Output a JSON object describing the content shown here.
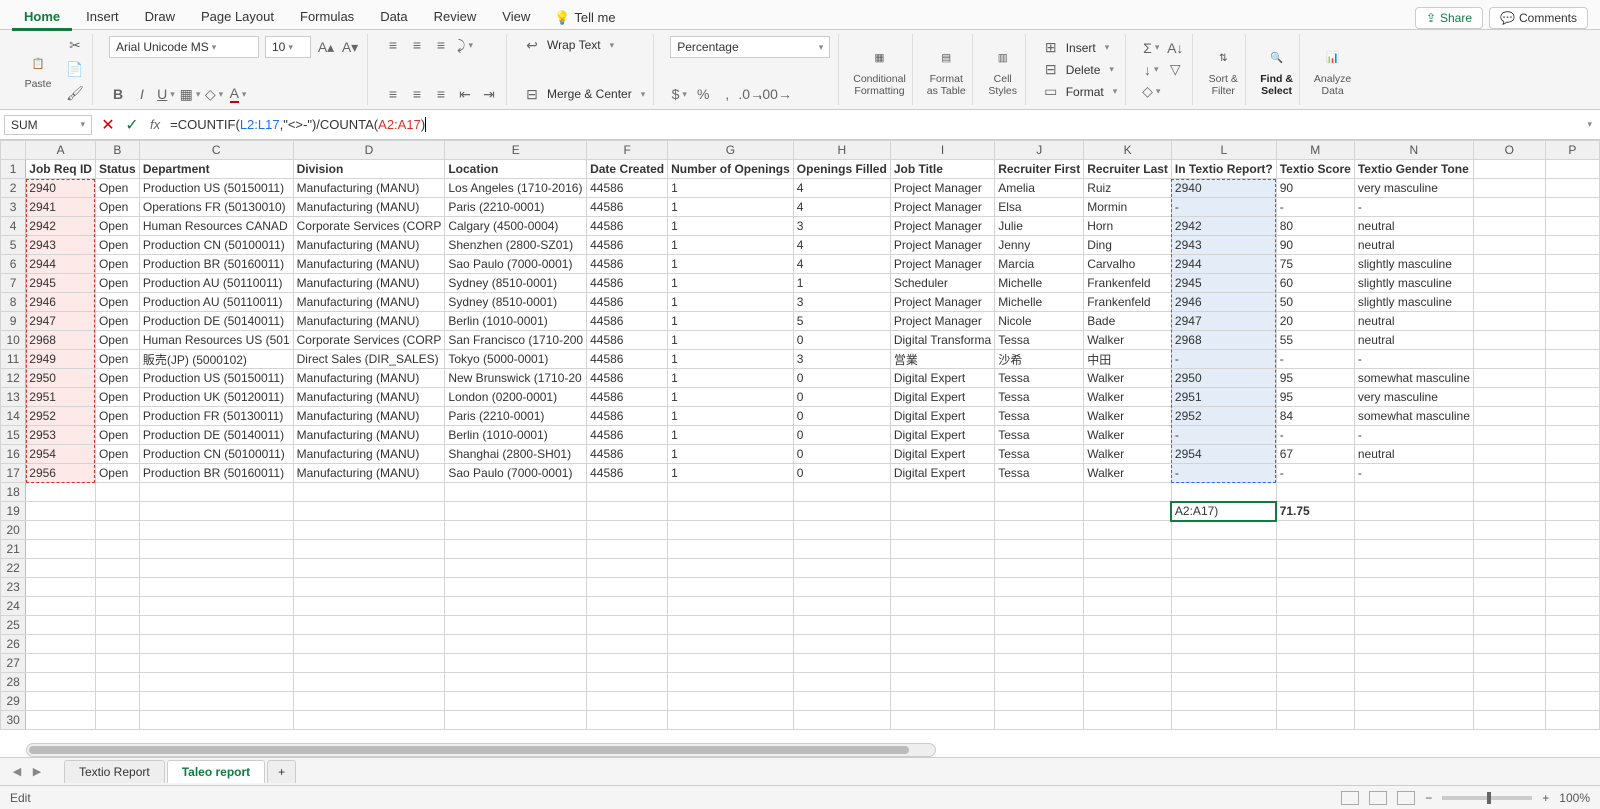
{
  "ribbonTabs": [
    "Home",
    "Insert",
    "Draw",
    "Page Layout",
    "Formulas",
    "Data",
    "Review",
    "View"
  ],
  "tellMe": "Tell me",
  "shareLabel": "Share",
  "commentsLabel": "Comments",
  "clipboard": {
    "paste": "Paste"
  },
  "font": {
    "name": "Arial Unicode MS",
    "size": "10"
  },
  "wrap": "Wrap Text",
  "merge": "Merge & Center",
  "numfmt": "Percentage",
  "cond": "Conditional\nFormatting",
  "fmtTable": "Format\nas Table",
  "cellStyles": "Cell\nStyles",
  "cells": {
    "insert": "Insert",
    "delete": "Delete",
    "format": "Format"
  },
  "sort": "Sort &\nFilter",
  "find": "Find &\nSelect",
  "analyze": "Analyze\nData",
  "nameBox": "SUM",
  "formula": {
    "pre": "=COUNTIF(",
    "ref1": "L2:L17",
    "mid": ",\"<>-\")/COUNTA(",
    "ref2": "A2:A17",
    "post": ")"
  },
  "columns": [
    "A",
    "B",
    "C",
    "D",
    "E",
    "F",
    "G",
    "H",
    "I",
    "J",
    "K",
    "L",
    "M",
    "N",
    "O",
    "P"
  ],
  "headers": [
    "Job Req ID",
    "Status",
    "Department",
    "Division",
    "Location",
    "Date Created",
    "Number of Openings",
    "Openings Filled",
    "Job Title",
    "Recruiter First",
    "Recruiter Last",
    "In Textio Report?",
    "Textio Score",
    "Textio Gender Tone"
  ],
  "rows": [
    [
      "2940",
      "Open",
      "Production US (50150011)",
      "Manufacturing (MANU)",
      "Los Angeles (1710-2016)",
      "44586",
      "1",
      "4",
      "Project Manager",
      "Amelia",
      "Ruiz",
      "2940",
      "90",
      "very masculine"
    ],
    [
      "2941",
      "Open",
      "Operations FR (50130010)",
      "Manufacturing (MANU)",
      "Paris (2210-0001)",
      "44586",
      "1",
      "4",
      "Project Manager",
      "Elsa",
      "Mormin",
      "-",
      "-",
      "-"
    ],
    [
      "2942",
      "Open",
      "Human Resources CANAD",
      "Corporate Services (CORP",
      "Calgary (4500-0004)",
      "44586",
      "1",
      "3",
      "Project Manager",
      "Julie",
      "Horn",
      "2942",
      "80",
      "neutral"
    ],
    [
      "2943",
      "Open",
      "Production CN (50100011)",
      "Manufacturing (MANU)",
      "Shenzhen (2800-SZ01)",
      "44586",
      "1",
      "4",
      "Project Manager",
      "Jenny",
      "Ding",
      "2943",
      "90",
      "neutral"
    ],
    [
      "2944",
      "Open",
      "Production BR (50160011)",
      "Manufacturing (MANU)",
      "Sao Paulo (7000-0001)",
      "44586",
      "1",
      "4",
      "Project Manager",
      "Marcia",
      "Carvalho",
      "2944",
      "75",
      "slightly masculine"
    ],
    [
      "2945",
      "Open",
      "Production AU (50110011)",
      "Manufacturing (MANU)",
      "Sydney (8510-0001)",
      "44586",
      "1",
      "1",
      "Scheduler",
      "Michelle",
      "Frankenfeld",
      "2945",
      "60",
      "slightly masculine"
    ],
    [
      "2946",
      "Open",
      "Production AU (50110011)",
      "Manufacturing (MANU)",
      "Sydney (8510-0001)",
      "44586",
      "1",
      "3",
      "Project Manager",
      "Michelle",
      "Frankenfeld",
      "2946",
      "50",
      "slightly masculine"
    ],
    [
      "2947",
      "Open",
      "Production DE (50140011)",
      "Manufacturing (MANU)",
      "Berlin (1010-0001)",
      "44586",
      "1",
      "5",
      "Project Manager",
      "Nicole",
      "Bade",
      "2947",
      "20",
      "neutral"
    ],
    [
      "2968",
      "Open",
      "Human Resources US (501",
      "Corporate Services (CORP",
      "San Francisco (1710-200",
      "44586",
      "1",
      "0",
      "Digital Transforma",
      "Tessa",
      "Walker",
      "2968",
      "55",
      "neutral"
    ],
    [
      "2949",
      "Open",
      "販売(JP) (5000102)",
      "Direct Sales (DIR_SALES)",
      "Tokyo (5000-0001)",
      "44586",
      "1",
      "3",
      "営業",
      "沙希",
      "中田",
      "-",
      "-",
      "-"
    ],
    [
      "2950",
      "Open",
      "Production US (50150011)",
      "Manufacturing (MANU)",
      "New Brunswick (1710-20",
      "44586",
      "1",
      "0",
      "Digital Expert",
      "Tessa",
      "Walker",
      "2950",
      "95",
      "somewhat masculine"
    ],
    [
      "2951",
      "Open",
      "Production UK (50120011)",
      "Manufacturing (MANU)",
      "London (0200-0001)",
      "44586",
      "1",
      "0",
      "Digital Expert",
      "Tessa",
      "Walker",
      "2951",
      "95",
      "very masculine"
    ],
    [
      "2952",
      "Open",
      "Production FR (50130011)",
      "Manufacturing (MANU)",
      "Paris (2210-0001)",
      "44586",
      "1",
      "0",
      "Digital Expert",
      "Tessa",
      "Walker",
      "2952",
      "84",
      "somewhat masculine"
    ],
    [
      "2953",
      "Open",
      "Production DE (50140011)",
      "Manufacturing (MANU)",
      "Berlin (1010-0001)",
      "44586",
      "1",
      "0",
      "Digital Expert",
      "Tessa",
      "Walker",
      "-",
      "-",
      "-"
    ],
    [
      "2954",
      "Open",
      "Production CN (50100011)",
      "Manufacturing (MANU)",
      "Shanghai (2800-SH01)",
      "44586",
      "1",
      "0",
      "Digital Expert",
      "Tessa",
      "Walker",
      "2954",
      "67",
      "neutral"
    ],
    [
      "2956",
      "Open",
      "Production BR (50160011)",
      "Manufacturing (MANU)",
      "Sao Paulo (7000-0001)",
      "44586",
      "1",
      "0",
      "Digital Expert",
      "Tessa",
      "Walker",
      "-",
      "-",
      "-"
    ]
  ],
  "footerCell": {
    "L": "A2:A17)",
    "M": "71.75"
  },
  "sheets": [
    "Textio Report",
    "Taleo report"
  ],
  "activeSheet": 1,
  "status": "Edit",
  "zoom": "100%"
}
